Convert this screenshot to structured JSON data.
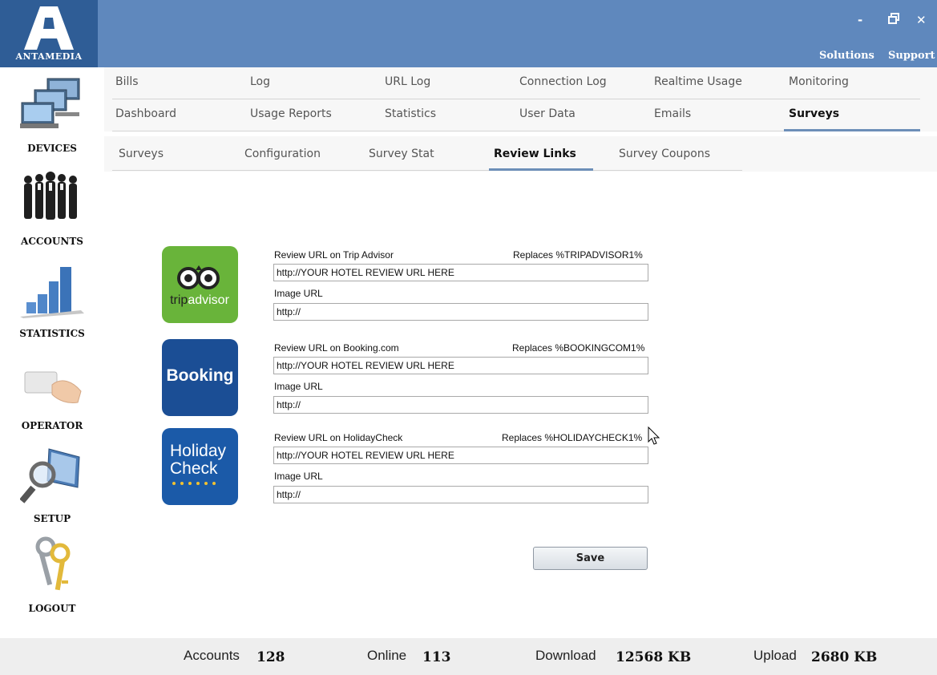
{
  "header": {
    "brand": "ANTAMEDIA",
    "minimize": "-",
    "restore": "▫",
    "close": "✕",
    "solutions": "Solutions",
    "support": "Support"
  },
  "sidebar": {
    "items": [
      {
        "label": "DEVICES",
        "icon": "computers-icon"
      },
      {
        "label": "ACCOUNTS",
        "icon": "people-icon"
      },
      {
        "label": "STATISTICS",
        "icon": "bar-chart-icon"
      },
      {
        "label": "OPERATOR",
        "icon": "card-hand-icon"
      },
      {
        "label": "SETUP",
        "icon": "magnifier-monitor-icon"
      },
      {
        "label": "LOGOUT",
        "icon": "keys-icon"
      }
    ]
  },
  "nav": {
    "row1": [
      "Bills",
      "Log",
      "URL Log",
      "Connection Log",
      "Realtime Usage",
      "Monitoring"
    ],
    "row2": [
      "Dashboard",
      "Usage Reports",
      "Statistics",
      "User Data",
      "Emails",
      "Surveys"
    ],
    "active": "Surveys"
  },
  "subnav": {
    "items": [
      "Surveys",
      "Configuration",
      "Survey Stat",
      "Review Links",
      "Survey Coupons"
    ],
    "active": "Review Links"
  },
  "reviews": [
    {
      "brand": "tripadvisor",
      "brand_prefix": "trip",
      "brand_suffix": "advisor",
      "url_label": "Review URL on Trip Advisor",
      "replaces": "Replaces %TRIPADVISOR1%",
      "url_value": "http://YOUR HOTEL REVIEW URL HERE",
      "image_label": "Image URL",
      "image_value": "http://",
      "color": "#69b43a"
    },
    {
      "brand": "Booking",
      "url_label": "Review URL on Booking.com",
      "replaces": "Replaces %BOOKINGCOM1%",
      "url_value": "http://YOUR HOTEL REVIEW URL HERE",
      "image_label": "Image URL",
      "image_value": "http://",
      "color": "#1b4e95"
    },
    {
      "brand_line1": "Holiday",
      "brand_line2": "Check",
      "url_label": "Review URL on HolidayCheck",
      "replaces": "Replaces %HOLIDAYCHECK1%",
      "url_value": "http://YOUR HOTEL REVIEW URL HERE",
      "image_label": "Image URL",
      "image_value": "http://",
      "color": "#1b5aa8"
    }
  ],
  "save_label": "Save",
  "footer": {
    "accounts_label": "Accounts",
    "accounts_value": "128",
    "online_label": "Online",
    "online_value": "113",
    "download_label": "Download",
    "download_value": "12568 KB",
    "upload_label": "Upload",
    "upload_value": "2680 KB"
  }
}
